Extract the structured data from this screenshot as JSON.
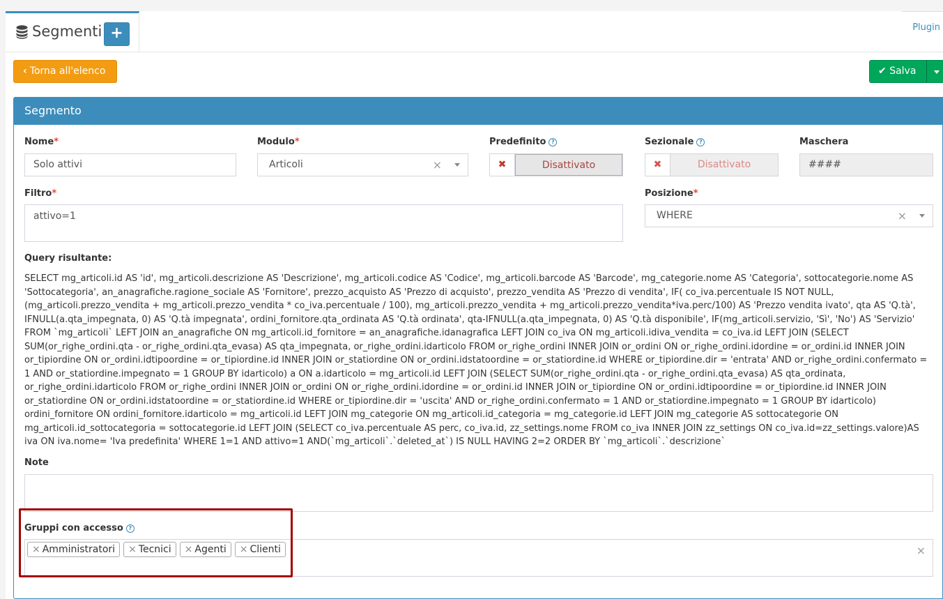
{
  "header": {
    "title": "Segmenti",
    "add_label": "+",
    "plugin_label": "Plugin",
    "db_icon": "database-icon"
  },
  "toolbar": {
    "back_label": "Torna all'elenco",
    "save_label": "Salva"
  },
  "panel": {
    "title": "Segmento"
  },
  "form": {
    "nome": {
      "label": "Nome",
      "value": "Solo attivi"
    },
    "modulo": {
      "label": "Modulo",
      "value": "Articoli"
    },
    "predefinito": {
      "label": "Predefinito",
      "value": "Disattivato"
    },
    "sezionale": {
      "label": "Sezionale",
      "value": "Disattivato"
    },
    "maschera": {
      "label": "Maschera",
      "value": "####"
    },
    "filtro": {
      "label": "Filtro",
      "value": "attivo=1"
    },
    "posizione": {
      "label": "Posizione",
      "value": "WHERE"
    },
    "query": {
      "label": "Query risultante:",
      "value": "SELECT mg_articoli.id AS 'id', mg_articoli.descrizione AS 'Descrizione', mg_articoli.codice AS 'Codice', mg_articoli.barcode AS 'Barcode', mg_categorie.nome AS 'Categoria', sottocategorie.nome AS 'Sottocategoria', an_anagrafiche.ragione_sociale AS 'Fornitore', prezzo_acquisto AS 'Prezzo di acquisto', prezzo_vendita AS 'Prezzo di vendita', IF( co_iva.percentuale IS NOT NULL, (mg_articoli.prezzo_vendita + mg_articoli.prezzo_vendita * co_iva.percentuale / 100), mg_articoli.prezzo_vendita + mg_articoli.prezzo_vendita*iva.perc/100) AS 'Prezzo vendita ivato', qta AS 'Q.tà', IFNULL(a.qta_impegnata, 0) AS 'Q.tà impegnata', ordini_fornitore.qta_ordinata AS 'Q.tà ordinata', qta-IFNULL(a.qta_impegnata, 0) AS 'Q.tà disponibile', IF(mg_articoli.servizio, 'Sì', 'No') AS 'Servizio' FROM `mg_articoli` LEFT JOIN an_anagrafiche ON mg_articoli.id_fornitore = an_anagrafiche.idanagrafica LEFT JOIN co_iva ON mg_articoli.idiva_vendita = co_iva.id LEFT JOIN (SELECT SUM(or_righe_ordini.qta - or_righe_ordini.qta_evasa) AS qta_impegnata, or_righe_ordini.idarticolo FROM or_righe_ordini INNER JOIN or_ordini ON or_righe_ordini.idordine = or_ordini.id INNER JOIN or_tipiordine ON or_ordini.idtipoordine = or_tipiordine.id INNER JOIN or_statiordine ON or_ordini.idstatoordine = or_statiordine.id WHERE or_tipiordine.dir = 'entrata' AND or_righe_ordini.confermato = 1 AND or_statiordine.impegnato = 1 GROUP BY idarticolo) a ON a.idarticolo = mg_articoli.id LEFT JOIN (SELECT SUM(or_righe_ordini.qta - or_righe_ordini.qta_evasa) AS qta_ordinata, or_righe_ordini.idarticolo FROM or_righe_ordini INNER JOIN or_ordini ON or_righe_ordini.idordine = or_ordini.id INNER JOIN or_tipiordine ON or_ordini.idtipoordine = or_tipiordine.id INNER JOIN or_statiordine ON or_ordini.idstatoordine = or_statiordine.id WHERE or_tipiordine.dir = 'uscita' AND or_righe_ordini.confermato = 1 AND or_statiordine.impegnato = 1 GROUP BY idarticolo) ordini_fornitore ON ordini_fornitore.idarticolo = mg_articoli.id LEFT JOIN mg_categorie ON mg_articoli.id_categoria = mg_categorie.id LEFT JOIN mg_categorie AS sottocategorie ON mg_articoli.id_sottocategoria = sottocategorie.id LEFT JOIN (SELECT co_iva.percentuale AS perc, co_iva.id, zz_settings.nome FROM co_iva INNER JOIN zz_settings ON co_iva.id=zz_settings.valore)AS iva ON iva.nome= 'Iva predefinita' WHERE 1=1 AND attivo=1 AND(`mg_articoli`.`deleted_at`) IS NULL HAVING 2=2 ORDER BY `mg_articoli`.`descrizione`"
    },
    "note": {
      "label": "Note",
      "value": ""
    },
    "gruppi": {
      "label": "Gruppi con accesso",
      "items": [
        "Amministratori",
        "Tecnici",
        "Agenti",
        "Clienti"
      ]
    }
  },
  "colors": {
    "primary": "#3c8dbc",
    "warning": "#f39c12",
    "success": "#00a65a",
    "danger": "#dd4b39",
    "highlight": "#a30000"
  }
}
